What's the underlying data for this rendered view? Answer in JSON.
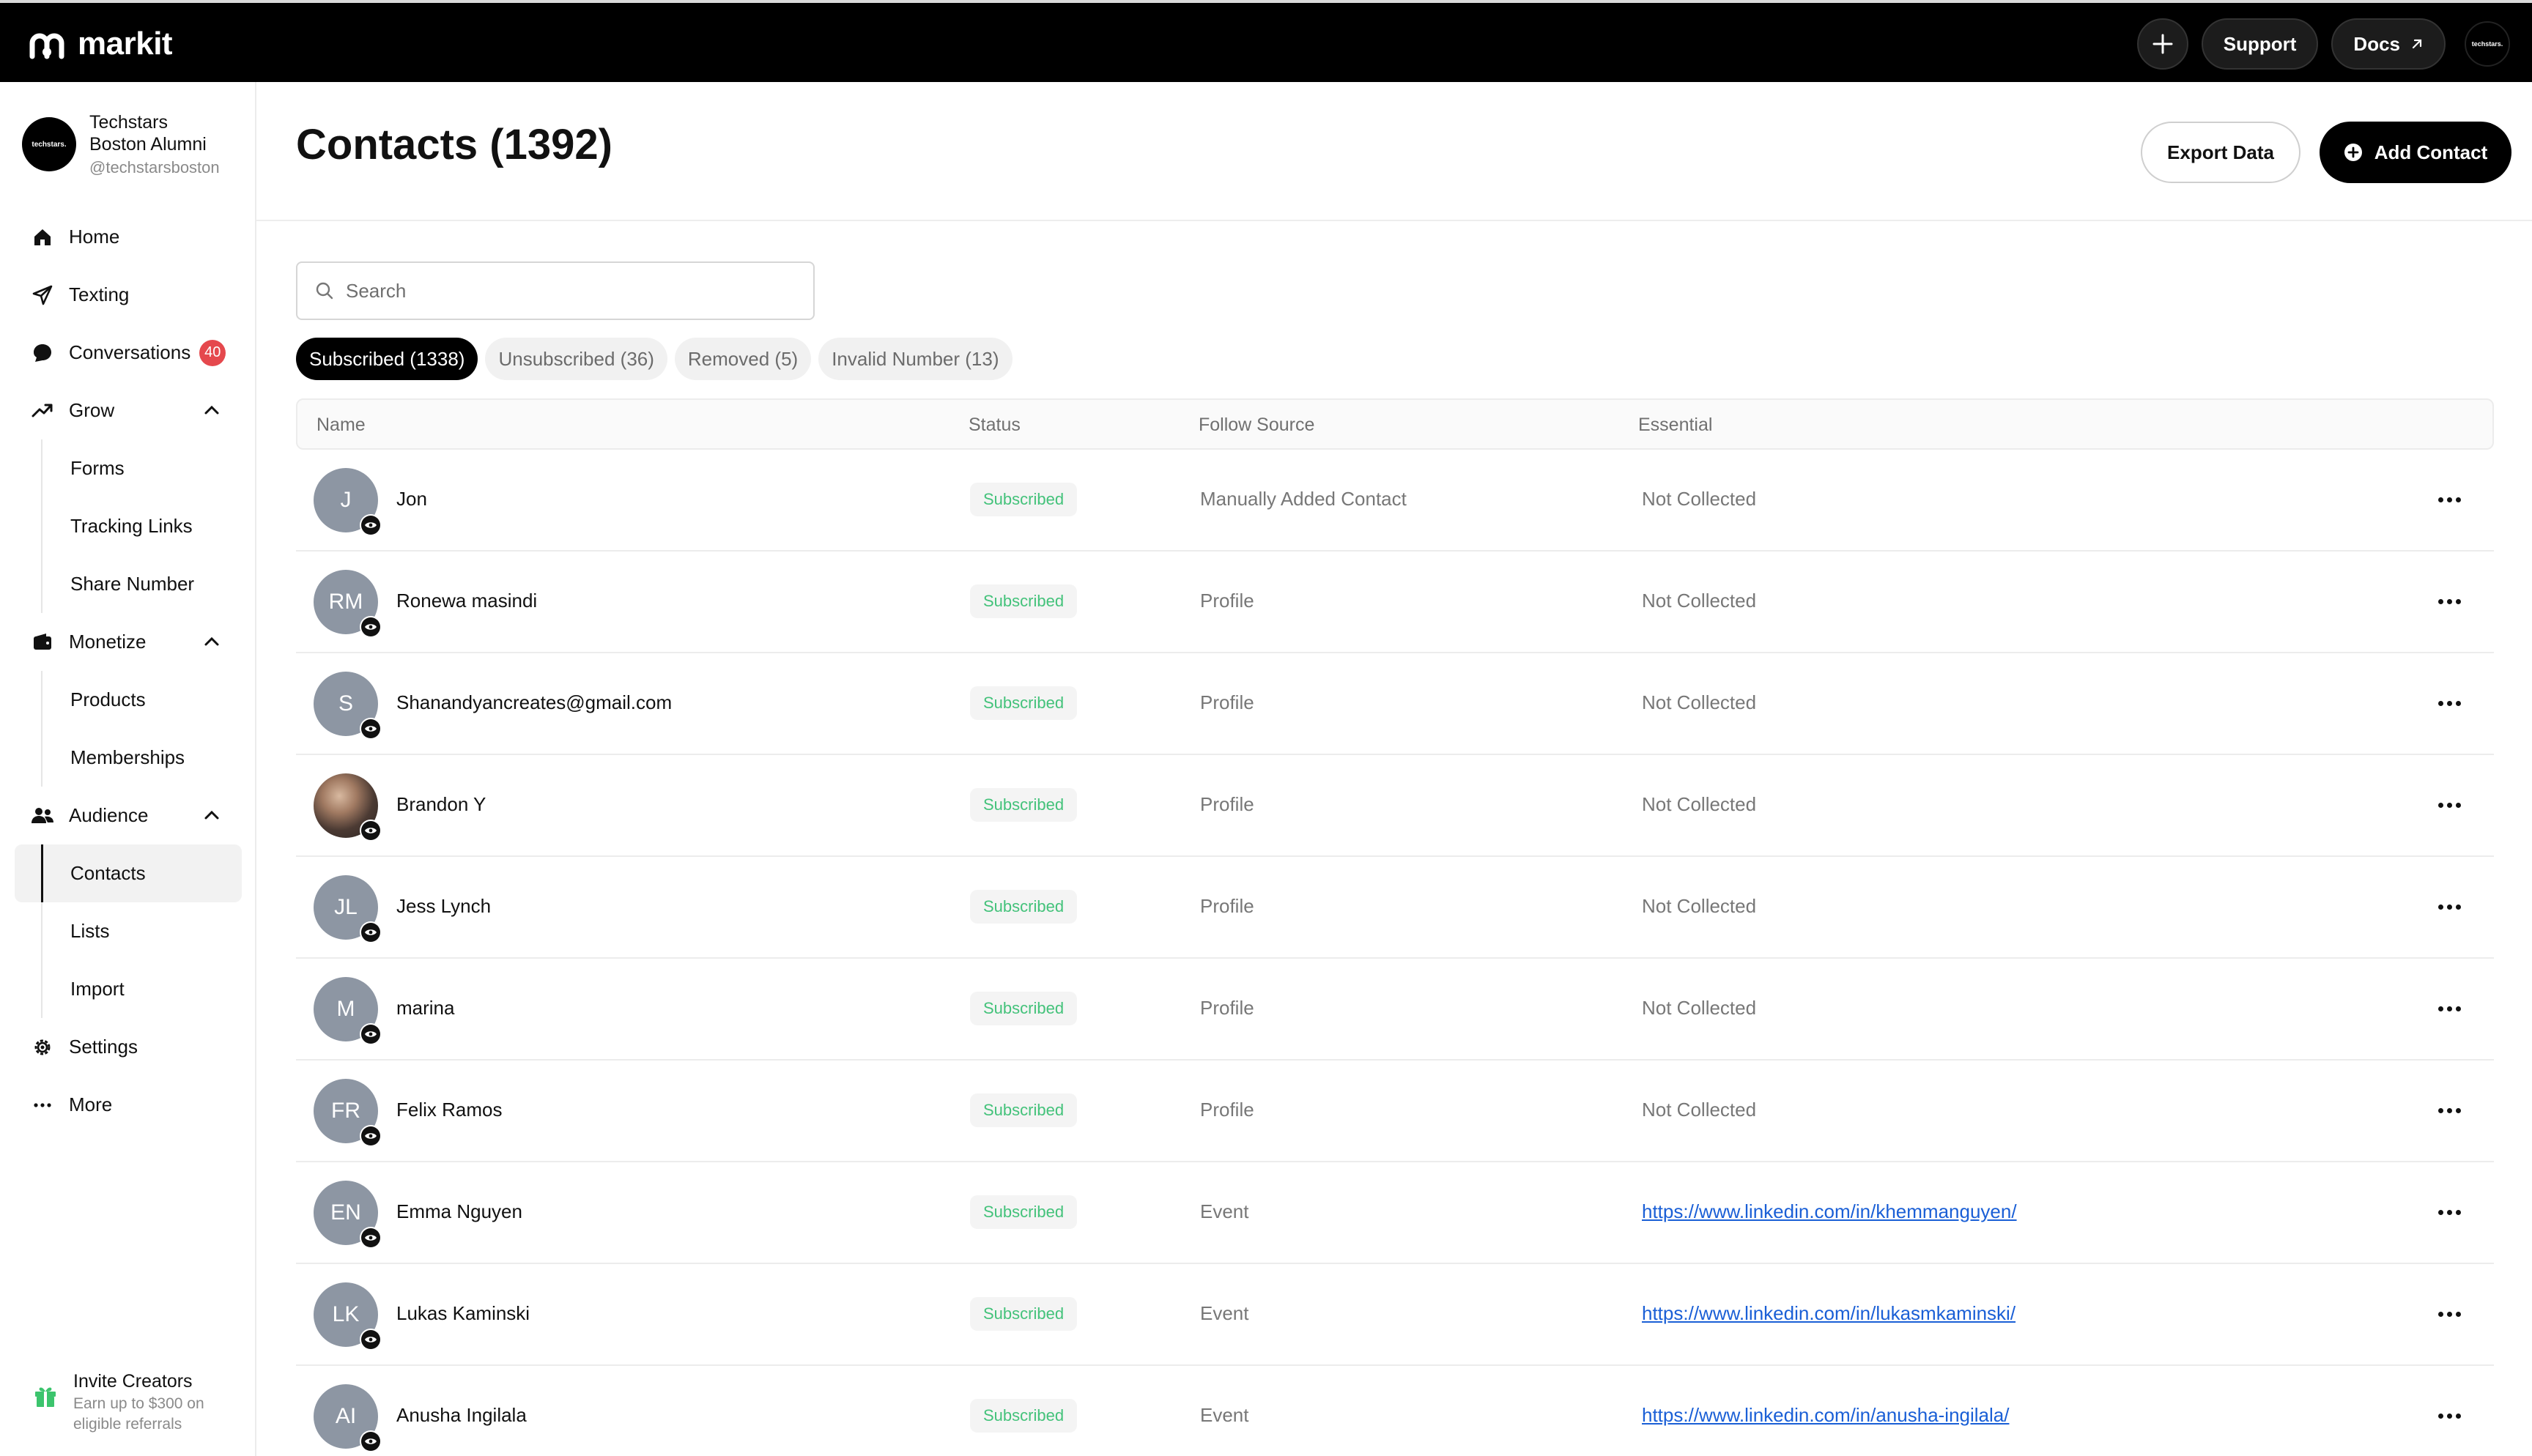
{
  "brand": {
    "name": "markit"
  },
  "topbar": {
    "support_label": "Support",
    "docs_label": "Docs",
    "avatar_text": "techstars."
  },
  "org": {
    "name_line1": "Techstars",
    "name_line2": "Boston Alumni",
    "handle": "@techstarsboston",
    "avatar_text": "techstars."
  },
  "sidebar": {
    "home": "Home",
    "texting": "Texting",
    "conversations": "Conversations",
    "conversations_badge": "40",
    "grow": "Grow",
    "forms": "Forms",
    "tracking_links": "Tracking Links",
    "share_number": "Share Number",
    "monetize": "Monetize",
    "products": "Products",
    "memberships": "Memberships",
    "audience": "Audience",
    "contacts": "Contacts",
    "lists": "Lists",
    "import": "Import",
    "settings": "Settings",
    "more": "More"
  },
  "invite": {
    "title": "Invite Creators",
    "desc": "Earn up to $300 on eligible referrals"
  },
  "header": {
    "title": "Contacts (1392)",
    "export_label": "Export Data",
    "add_label": "Add Contact"
  },
  "search": {
    "placeholder": "Search",
    "value": ""
  },
  "tabs": [
    {
      "label": "Subscribed (1338)"
    },
    {
      "label": "Unsubscribed (36)"
    },
    {
      "label": "Removed (5)"
    },
    {
      "label": "Invalid Number (13)"
    }
  ],
  "table": {
    "headers": {
      "name": "Name",
      "status": "Status",
      "source": "Follow Source",
      "essential": "Essential"
    },
    "rows": [
      {
        "initials": "J",
        "name": "Jon",
        "status": "Subscribed",
        "source": "Manually Added Contact",
        "essential": "Not Collected"
      },
      {
        "initials": "RM",
        "name": "Ronewa masindi",
        "status": "Subscribed",
        "source": "Profile",
        "essential": "Not Collected"
      },
      {
        "initials": "S",
        "name": "Shanandyancreates@gmail.com",
        "status": "Subscribed",
        "source": "Profile",
        "essential": "Not Collected"
      },
      {
        "initials": "",
        "name": "Brandon Y",
        "status": "Subscribed",
        "source": "Profile",
        "essential": "Not Collected"
      },
      {
        "initials": "JL",
        "name": "Jess Lynch",
        "status": "Subscribed",
        "source": "Profile",
        "essential": "Not Collected"
      },
      {
        "initials": "M",
        "name": "marina",
        "status": "Subscribed",
        "source": "Profile",
        "essential": "Not Collected"
      },
      {
        "initials": "FR",
        "name": "Felix Ramos",
        "status": "Subscribed",
        "source": "Profile",
        "essential": "Not Collected"
      },
      {
        "initials": "EN",
        "name": "Emma Nguyen",
        "status": "Subscribed",
        "source": "Event",
        "essential": "https://www.linkedin.com/in/khemmanguyen/"
      },
      {
        "initials": "LK",
        "name": "Lukas Kaminski",
        "status": "Subscribed",
        "source": "Event",
        "essential": "https://www.linkedin.com/in/lukasmkaminski/"
      },
      {
        "initials": "AI",
        "name": "Anusha Ingilala",
        "status": "Subscribed",
        "source": "Event",
        "essential": "https://www.linkedin.com/in/anusha-ingilala/"
      }
    ]
  },
  "colors": {
    "accent": "#000000",
    "status_green": "#43c27a",
    "link_blue": "#1a5fd6",
    "badge_red": "#e5484d",
    "avatar_gray": "#8d96a3"
  }
}
